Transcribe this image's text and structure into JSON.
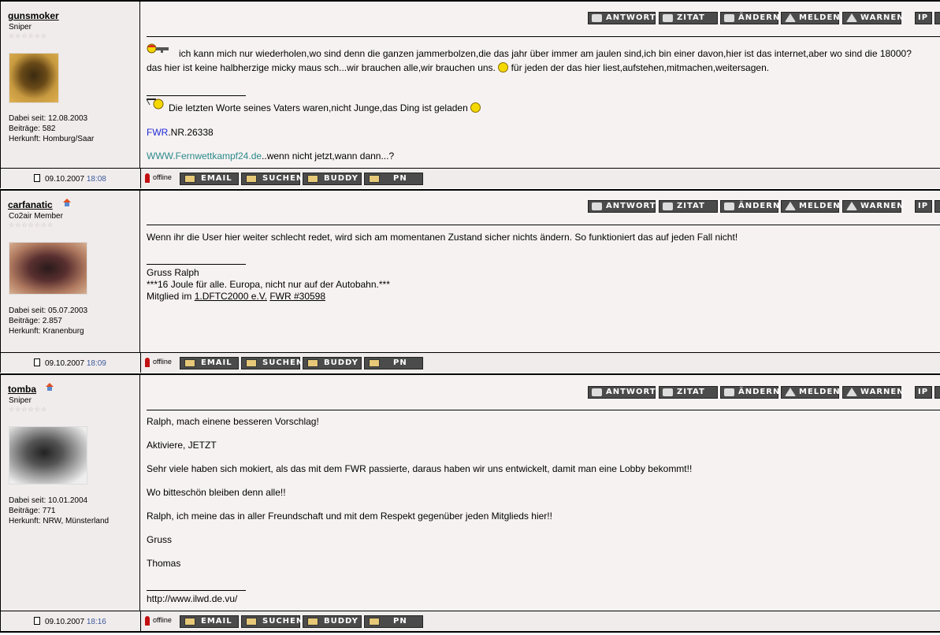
{
  "buttons": {
    "antwort": "ANTWORT",
    "zitat": "ZITAT",
    "aendern": "ÄNDERN",
    "melden": "MELDEN",
    "warnen": "WARNEN",
    "ip": "IP",
    "email": "EMAIL",
    "suchen": "SUCHEN",
    "buddy": "BUDDY",
    "pn": "PN"
  },
  "offline_label": "offline",
  "posts": [
    {
      "username": "gunsmoker",
      "rank": "Sniper",
      "stars": "☆☆☆☆☆☆",
      "joined": "Dabei seit: 12.08.2003",
      "posts": "Beiträge: 582",
      "origin": "Herkunft: Homburg/Saar",
      "date": "09.10.2007",
      "time": "18:08",
      "body": {
        "line1": "ich kann mich nur wiederholen,wo sind denn die ganzen jammerbolzen,die das jahr über immer am jaulen sind,ich bin einer davon,hier ist das internet,aber wo sind die 18000?",
        "line2a": "das hier ist keine halbherzige micky maus sch...wir brauchen alle,wir brauchen uns.",
        "line2b": "für jeden der das hier liest,aufstehen,mitmachen,weitersagen."
      },
      "signature": {
        "quote": "Die letzten Worte seines Vaters waren,nicht Junge,das Ding ist geladen",
        "fwr_link": "FWR",
        "fwr_rest": ".NR.26338",
        "web_link": "WWW.Fernwettkampf24.de",
        "web_rest": "..wenn nicht jetzt,wann dann...?"
      }
    },
    {
      "username": "carfanatic",
      "rank": "Co2air Member",
      "stars": "☆☆☆☆☆☆☆",
      "joined": "Dabei seit: 05.07.2003",
      "posts": "Beiträge: 2.857",
      "origin": "Herkunft: Kranenburg",
      "date": "09.10.2007",
      "time": "18:09",
      "body": {
        "line1": "Wenn ihr die User hier weiter schlecht redet, wird sich am momentanen Zustand sicher nichts ändern. So funktioniert das auf jeden Fall nicht!"
      },
      "signature": {
        "line1": "Gruss Ralph",
        "line2": "***16 Joule für alle. Europa, nicht nur auf der Autobahn.***",
        "line3_prefix": "Mitglied im ",
        "link1": "1.DFTC2000 e.V.",
        "link2": "FWR #30598"
      }
    },
    {
      "username": "tomba",
      "rank": "Sniper",
      "stars": "☆☆☆☆☆☆",
      "joined": "Dabei seit: 10.01.2004",
      "posts": "Beiträge: 771",
      "origin": "Herkunft: NRW, Münsterland",
      "date": "09.10.2007",
      "time": "18:16",
      "body": {
        "p1": "Ralph, mach einene besseren Vorschlag!",
        "p2": "Aktiviere, JETZT",
        "p3": "Sehr viele haben sich mokiert, als das mit dem FWR passierte, daraus haben wir uns entwickelt, damit man eine Lobby bekommt!!",
        "p4": "Wo bitteschön bleiben denn alle!!",
        "p5": "Ralph, ich meine das in aller Freundschaft und mit dem Respekt gegenüber jeden Mitglieds hier!!",
        "p6": "Gruss",
        "p7": "Thomas"
      },
      "signature": {
        "line1": "http://www.ilwd.de.vu/"
      }
    }
  ]
}
